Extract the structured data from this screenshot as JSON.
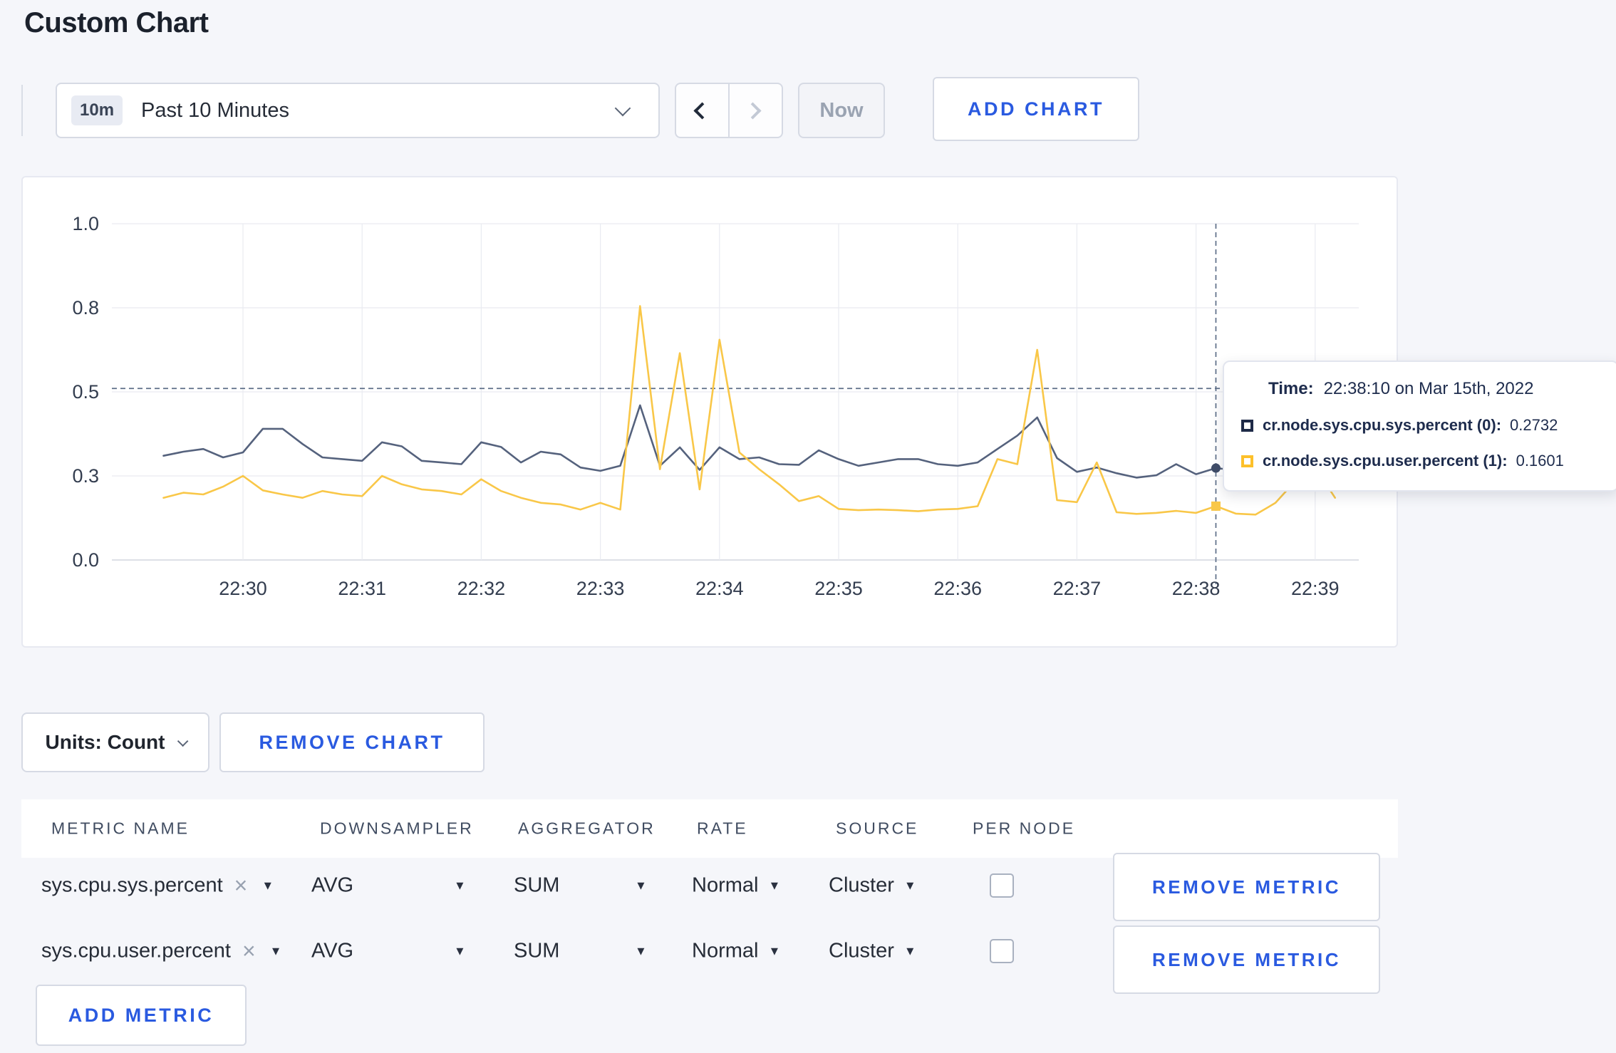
{
  "page": {
    "title": "Custom Chart",
    "background": "#f5f6fa",
    "accent_blue": "#2a5ae0"
  },
  "toolbar": {
    "time_badge": "10m",
    "time_label": "Past 10 Minutes",
    "now_label": "Now",
    "add_chart_label": "ADD CHART"
  },
  "chart_card": {
    "units_label": "Units: Count",
    "remove_chart_label": "REMOVE CHART"
  },
  "chart_data": {
    "type": "line",
    "title": "",
    "xlabel": "",
    "ylabel": "",
    "grid": true,
    "legend_position": "tooltip-only",
    "ylim": [
      0,
      1
    ],
    "y_ticks": [
      {
        "label": "0.0",
        "value": 0
      },
      {
        "label": "0.3",
        "value": 0.25
      },
      {
        "label": "0.5",
        "value": 0.5
      },
      {
        "label": "0.8",
        "value": 0.75
      },
      {
        "label": "1.0",
        "value": 1
      }
    ],
    "x_ticks": [
      "22:30",
      "22:31",
      "22:32",
      "22:33",
      "22:34",
      "22:35",
      "22:36",
      "22:37",
      "22:38",
      "22:39"
    ],
    "sample_interval_seconds": 10,
    "first_sample_offset_seconds": -40,
    "start_time": "22:29:20",
    "series": [
      {
        "name": "cr.node.sys.cpu.sys.percent",
        "node": "0",
        "color": "#55627d",
        "values": [
          0.31,
          0.322,
          0.33,
          0.305,
          0.32,
          0.39,
          0.39,
          0.345,
          0.305,
          0.3,
          0.295,
          0.35,
          0.338,
          0.295,
          0.29,
          0.285,
          0.35,
          0.336,
          0.29,
          0.322,
          0.314,
          0.275,
          0.265,
          0.28,
          0.46,
          0.28,
          0.335,
          0.268,
          0.335,
          0.3,
          0.305,
          0.285,
          0.283,
          0.326,
          0.3,
          0.28,
          0.29,
          0.3,
          0.3,
          0.285,
          0.28,
          0.29,
          0.33,
          0.37,
          0.424,
          0.303,
          0.262,
          0.275,
          0.258,
          0.245,
          0.252,
          0.285,
          0.255,
          0.2732,
          0.267,
          0.26,
          0.27,
          0.28,
          0.295,
          0.3
        ]
      },
      {
        "name": "cr.node.sys.cpu.user.percent",
        "node": "1",
        "color": "#f9c748",
        "values": [
          0.185,
          0.2,
          0.195,
          0.218,
          0.25,
          0.207,
          0.195,
          0.185,
          0.205,
          0.195,
          0.19,
          0.25,
          0.225,
          0.21,
          0.205,
          0.195,
          0.24,
          0.205,
          0.185,
          0.17,
          0.165,
          0.15,
          0.17,
          0.15,
          0.755,
          0.27,
          0.615,
          0.21,
          0.655,
          0.32,
          0.27,
          0.225,
          0.175,
          0.19,
          0.152,
          0.148,
          0.15,
          0.148,
          0.145,
          0.15,
          0.152,
          0.16,
          0.3,
          0.285,
          0.625,
          0.178,
          0.172,
          0.29,
          0.142,
          0.137,
          0.14,
          0.146,
          0.14,
          0.1601,
          0.138,
          0.135,
          0.17,
          0.235,
          0.275,
          0.185
        ]
      }
    ],
    "hover": {
      "index": 53,
      "time": "22:38:10",
      "value_guide": 0.51
    }
  },
  "tooltip": {
    "time_label": "Time:",
    "time_value": "22:38:10 on Mar 15th, 2022",
    "rows": [
      {
        "label": "cr.node.sys.cpu.sys.percent (0):",
        "value": "0.2732",
        "swatch": "#1e2a47"
      },
      {
        "label": "cr.node.sys.cpu.user.percent (1):",
        "value": "0.1601",
        "swatch": "#fdc02a"
      }
    ]
  },
  "metrics_table": {
    "headers": [
      "METRIC NAME",
      "DOWNSAMPLER",
      "AGGREGATOR",
      "RATE",
      "SOURCE",
      "PER NODE"
    ],
    "rows": [
      {
        "metric": "sys.cpu.sys.percent",
        "downsampler": "AVG",
        "aggregator": "SUM",
        "rate": "Normal",
        "source": "Cluster",
        "per_node_checked": false,
        "remove_label": "REMOVE METRIC"
      },
      {
        "metric": "sys.cpu.user.percent",
        "downsampler": "AVG",
        "aggregator": "SUM",
        "rate": "Normal",
        "source": "Cluster",
        "per_node_checked": false,
        "remove_label": "REMOVE METRIC"
      }
    ],
    "add_metric_label": "ADD METRIC"
  }
}
